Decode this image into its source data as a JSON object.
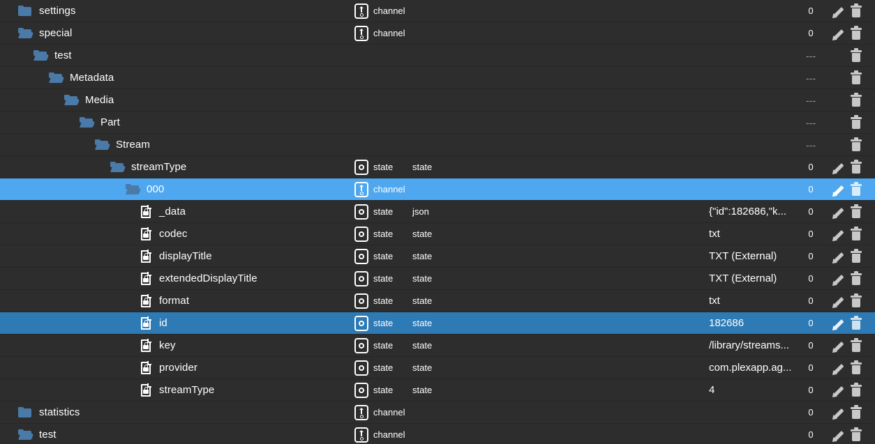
{
  "theme": {
    "background": "#2d2d2d",
    "row_separator": "#262626",
    "selected_bright": "#4fa8ef",
    "selected_muted": "#2e7ab5",
    "folder_blue": "#4a7aa7",
    "text": "#ffffff",
    "muted_text": "#9a9a9a",
    "action_icon": "#c8c8c8"
  },
  "labels": {
    "dash": "---",
    "edit_icon": "pencil-icon",
    "delete_icon": "trash-icon"
  },
  "rows": [
    {
      "name": "settings",
      "node": "folder-closed",
      "depth": 0,
      "type_icon": "channel",
      "type_kind": "channel",
      "type_role": "",
      "value": "",
      "count": "0",
      "has_edit": true,
      "has_delete": true,
      "selection": "none"
    },
    {
      "name": "special",
      "node": "folder-open",
      "depth": 0,
      "type_icon": "channel",
      "type_kind": "channel",
      "type_role": "",
      "value": "",
      "count": "0",
      "has_edit": true,
      "has_delete": true,
      "selection": "none"
    },
    {
      "name": "test",
      "node": "folder-open",
      "depth": 1,
      "type_icon": "",
      "type_kind": "",
      "type_role": "",
      "value": "",
      "count": "---",
      "has_edit": false,
      "has_delete": true,
      "selection": "none"
    },
    {
      "name": "Metadata",
      "node": "folder-open",
      "depth": 2,
      "type_icon": "",
      "type_kind": "",
      "type_role": "",
      "value": "",
      "count": "---",
      "has_edit": false,
      "has_delete": true,
      "selection": "none"
    },
    {
      "name": "Media",
      "node": "folder-open",
      "depth": 3,
      "type_icon": "",
      "type_kind": "",
      "type_role": "",
      "value": "",
      "count": "---",
      "has_edit": false,
      "has_delete": true,
      "selection": "none"
    },
    {
      "name": "Part",
      "node": "folder-open",
      "depth": 4,
      "type_icon": "",
      "type_kind": "",
      "type_role": "",
      "value": "",
      "count": "---",
      "has_edit": false,
      "has_delete": true,
      "selection": "none"
    },
    {
      "name": "Stream",
      "node": "folder-open",
      "depth": 5,
      "type_icon": "",
      "type_kind": "",
      "type_role": "",
      "value": "",
      "count": "---",
      "has_edit": false,
      "has_delete": true,
      "selection": "none"
    },
    {
      "name": "streamType",
      "node": "folder-open",
      "depth": 6,
      "type_icon": "state",
      "type_kind": "state",
      "type_role": "state",
      "value": "",
      "count": "0",
      "has_edit": true,
      "has_delete": true,
      "selection": "none"
    },
    {
      "name": "000",
      "node": "folder-open",
      "depth": 7,
      "type_icon": "channel",
      "type_kind": "channel",
      "type_role": "",
      "value": "",
      "count": "0",
      "has_edit": true,
      "has_delete": true,
      "selection": "bright"
    },
    {
      "name": "_data",
      "node": "file-locked",
      "depth": 8,
      "type_icon": "state",
      "type_kind": "state",
      "type_role": "json",
      "value": "{\"id\":182686,\"k...",
      "count": "0",
      "has_edit": true,
      "has_delete": true,
      "selection": "none"
    },
    {
      "name": "codec",
      "node": "file-locked",
      "depth": 8,
      "type_icon": "state",
      "type_kind": "state",
      "type_role": "state",
      "value": "txt",
      "count": "0",
      "has_edit": true,
      "has_delete": true,
      "selection": "none"
    },
    {
      "name": "displayTitle",
      "node": "file-locked",
      "depth": 8,
      "type_icon": "state",
      "type_kind": "state",
      "type_role": "state",
      "value": "TXT (External)",
      "count": "0",
      "has_edit": true,
      "has_delete": true,
      "selection": "none"
    },
    {
      "name": "extendedDisplayTitle",
      "node": "file-locked",
      "depth": 8,
      "type_icon": "state",
      "type_kind": "state",
      "type_role": "state",
      "value": "TXT (External)",
      "count": "0",
      "has_edit": true,
      "has_delete": true,
      "selection": "none"
    },
    {
      "name": "format",
      "node": "file-locked",
      "depth": 8,
      "type_icon": "state",
      "type_kind": "state",
      "type_role": "state",
      "value": "txt",
      "count": "0",
      "has_edit": true,
      "has_delete": true,
      "selection": "none"
    },
    {
      "name": "id",
      "node": "file-locked",
      "depth": 8,
      "type_icon": "state",
      "type_kind": "state",
      "type_role": "state",
      "value": "182686",
      "count": "0",
      "has_edit": true,
      "has_delete": true,
      "selection": "muted"
    },
    {
      "name": "key",
      "node": "file-locked",
      "depth": 8,
      "type_icon": "state",
      "type_kind": "state",
      "type_role": "state",
      "value": "/library/streams...",
      "count": "0",
      "has_edit": true,
      "has_delete": true,
      "selection": "none"
    },
    {
      "name": "provider",
      "node": "file-locked",
      "depth": 8,
      "type_icon": "state",
      "type_kind": "state",
      "type_role": "state",
      "value": "com.plexapp.ag...",
      "count": "0",
      "has_edit": true,
      "has_delete": true,
      "selection": "none"
    },
    {
      "name": "streamType",
      "node": "file-locked",
      "depth": 8,
      "type_icon": "state",
      "type_kind": "state",
      "type_role": "state",
      "value": "4",
      "count": "0",
      "has_edit": true,
      "has_delete": true,
      "selection": "none"
    },
    {
      "name": "statistics",
      "node": "folder-closed",
      "depth": 0,
      "type_icon": "channel",
      "type_kind": "channel",
      "type_role": "",
      "value": "",
      "count": "0",
      "has_edit": true,
      "has_delete": true,
      "selection": "none"
    },
    {
      "name": "test",
      "node": "folder-open",
      "depth": 0,
      "type_icon": "channel",
      "type_kind": "channel",
      "type_role": "",
      "value": "",
      "count": "0",
      "has_edit": true,
      "has_delete": true,
      "selection": "none"
    }
  ]
}
